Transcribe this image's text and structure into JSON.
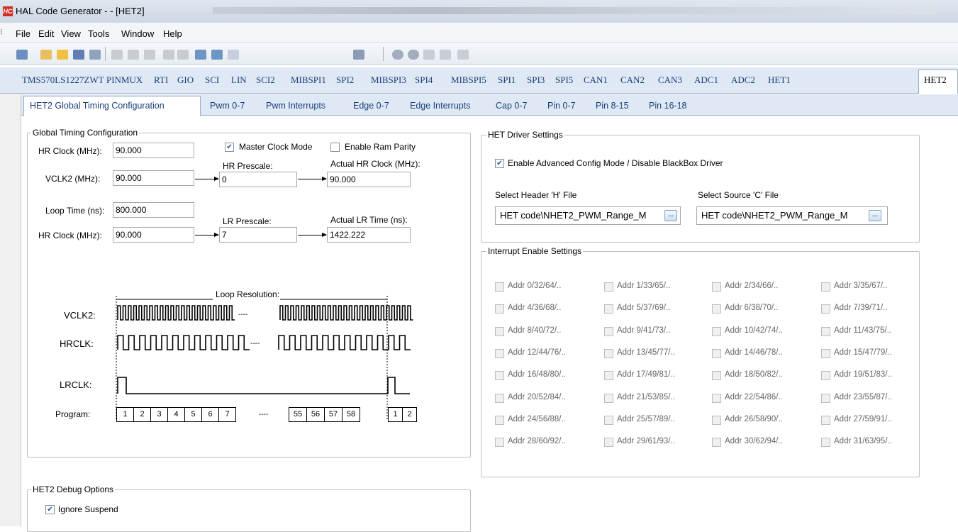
{
  "window": {
    "title": "HAL Code Generator -  - [HET2]",
    "app_badge": "HC"
  },
  "menu": [
    "File",
    "Edit",
    "View",
    "Tools",
    "Window",
    "Help"
  ],
  "module_tabs": [
    "TMS570LS1227ZWT",
    "PINMUX",
    "RTI",
    "GIO",
    "SCI",
    "LIN",
    "SCI2",
    "MIBSPI1",
    "SPI2",
    "MIBSPI3",
    "SPI4",
    "MIBSPI5",
    "SPI1",
    "SPI3",
    "SPI5",
    "CAN1",
    "CAN2",
    "CAN3",
    "ADC1",
    "ADC2",
    "HET1",
    "HET2"
  ],
  "sub_tabs": [
    "HET2 Global Timing Configuration",
    "Pwm 0-7",
    "Pwm Interrupts",
    "Edge 0-7",
    "Edge Interrupts",
    "Cap 0-7",
    "Pin 0-7",
    "Pin 8-15",
    "Pin 16-18"
  ],
  "global_timing": {
    "title": "Global Timing Configuration",
    "hr_clock_label": "HR Clock (MHz):",
    "hr_clock_value": "90.000",
    "master_clock_label": "Master Clock Mode",
    "master_clock_checked": true,
    "ram_parity_label": "Enable Ram Parity",
    "ram_parity_checked": false,
    "vclk2_label": "VCLK2 (MHz):",
    "vclk2_value": "90.000",
    "hr_prescale_label": "HR Prescale:",
    "hr_prescale_value": "0",
    "actual_hr_label": "Actual HR Clock (MHz):",
    "actual_hr_value": "90.000",
    "loop_time_label": "Loop Time (ns):",
    "loop_time_value": "800.000",
    "lr_prescale_label": "LR Prescale:",
    "lr_prescale_value": "7",
    "actual_lr_label": "Actual LR Time (ns):",
    "actual_lr_value": "1422.222",
    "hr_clock2_label": "HR Clock (MHz):",
    "hr_clock2_value": "90.000"
  },
  "timing_diagram": {
    "loop_resolution_label": "Loop Resolution:",
    "vclk2_label": "VCLK2:",
    "hrclk_label": "HRCLK:",
    "lrclk_label": "LRCLK:",
    "program_label": "Program:",
    "ellipsis": "----",
    "program_cells_a": [
      "1",
      "2",
      "3",
      "4",
      "5",
      "6",
      "7"
    ],
    "program_cells_b": [
      "55",
      "56",
      "57",
      "58"
    ],
    "program_cells_c": [
      "1",
      "2"
    ]
  },
  "het_driver": {
    "title": "HET Driver Settings",
    "advanced_label": "Enable Advanced Config Mode / Disable BlackBox Driver",
    "advanced_checked": true,
    "header_label": "Select Header 'H' File",
    "header_value": "HET code\\NHET2_PWM_Range_M",
    "source_label": "Select Source 'C' File",
    "source_value": "HET code\\NHET2_PWM_Range_M",
    "browse_label": "..."
  },
  "interrupts": {
    "title": "Interrupt Enable Settings",
    "items": [
      "Addr 0/32/64/..",
      "Addr 1/33/65/..",
      "Addr 2/34/66/..",
      "Addr 3/35/67/..",
      "Addr 4/36/68/..",
      "Addr 5/37/69/..",
      "Addr 6/38/70/..",
      "Addr 7/39/71/..",
      "Addr 8/40/72/..",
      "Addr 9/41/73/..",
      "Addr 10/42/74/..",
      "Addr 11/43/75/..",
      "Addr 12/44/76/..",
      "Addr 13/45/77/..",
      "Addr 14/46/78/..",
      "Addr 15/47/79/..",
      "Addr 16/48/80/..",
      "Addr 17/49/81/..",
      "Addr 18/50/82/..",
      "Addr 19/51/83/..",
      "Addr 20/52/84/..",
      "Addr 21/53/85/..",
      "Addr 22/54/86/..",
      "Addr 23/55/87/..",
      "Addr 24/56/88/..",
      "Addr 25/57/89/..",
      "Addr 26/58/90/..",
      "Addr 27/59/91/..",
      "Addr 28/60/92/..",
      "Addr 29/61/93/..",
      "Addr 30/62/94/..",
      "Addr 31/63/95/.."
    ]
  },
  "debug": {
    "title": "HET2 Debug Options",
    "ignore_suspend_label": "Ignore Suspend",
    "ignore_suspend_checked": true
  }
}
